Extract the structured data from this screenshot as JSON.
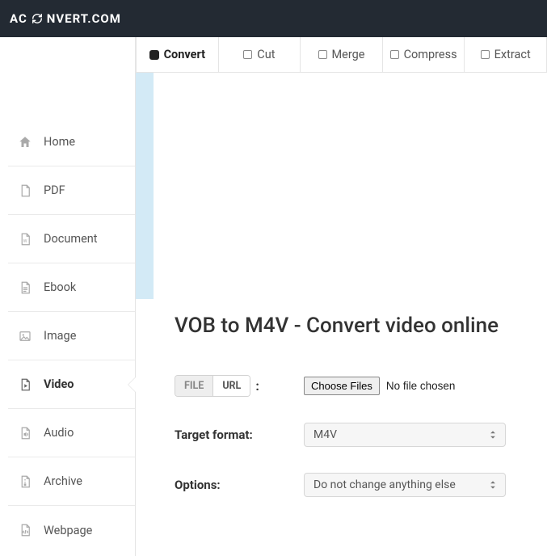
{
  "brand": {
    "left": "AC",
    "right": "NVERT.COM"
  },
  "sidebar": {
    "items": [
      {
        "label": "Home"
      },
      {
        "label": "PDF"
      },
      {
        "label": "Document"
      },
      {
        "label": "Ebook"
      },
      {
        "label": "Image"
      },
      {
        "label": "Video"
      },
      {
        "label": "Audio"
      },
      {
        "label": "Archive"
      },
      {
        "label": "Webpage"
      }
    ],
    "active_index": 5
  },
  "tabs": {
    "items": [
      {
        "label": "Convert"
      },
      {
        "label": "Cut"
      },
      {
        "label": "Merge"
      },
      {
        "label": "Compress"
      },
      {
        "label": "Extract"
      }
    ],
    "active_index": 0
  },
  "page": {
    "title": "VOB to M4V - Convert video online"
  },
  "source": {
    "file_label": "FILE",
    "url_label": "URL",
    "active": "file",
    "choose_button": "Choose Files",
    "no_file_text": "No file chosen"
  },
  "target": {
    "label": "Target format:",
    "value": "M4V"
  },
  "options": {
    "label": "Options:",
    "value": "Do not change anything else"
  }
}
